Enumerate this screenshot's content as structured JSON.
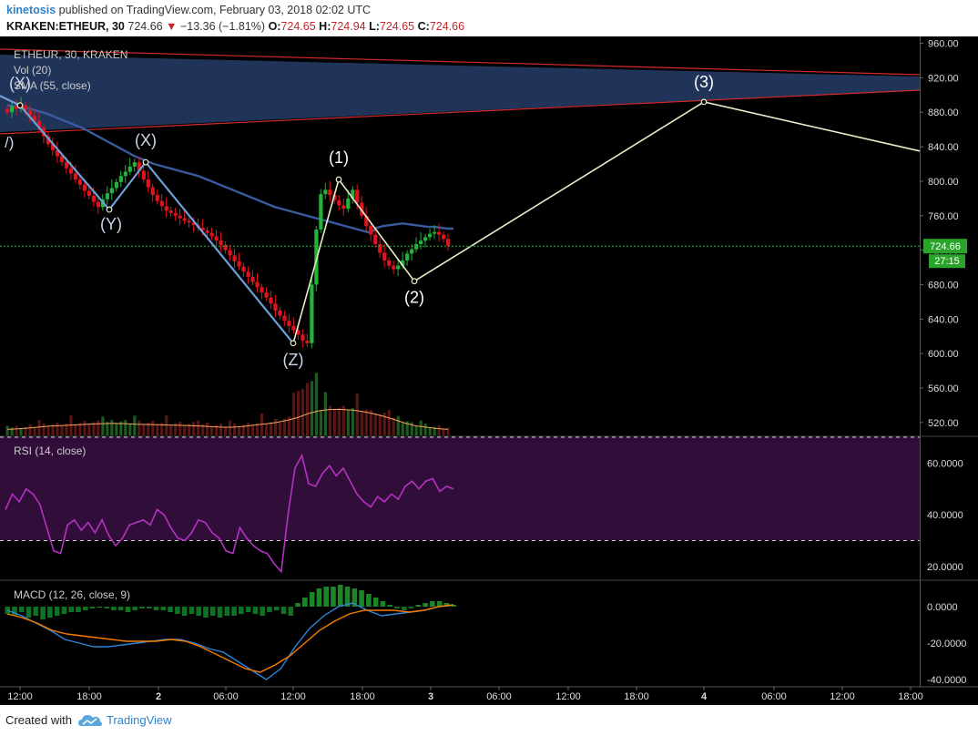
{
  "header": {
    "author": "kinetosis",
    "published_text": "published on TradingView.com, February 03, 2018 02:02 UTC",
    "symbol": "KRAKEN:ETHEUR, 30",
    "last": "724.66",
    "change_arrow": "▼",
    "change": "−13.36 (−1.81%)",
    "o_label": "O:",
    "o_value": "724.65",
    "h_label": "H:",
    "h_value": "724.94",
    "l_label": "L:",
    "l_value": "724.65",
    "c_label": "C:",
    "c_value": "724.66"
  },
  "footer": {
    "created_with": "Created with",
    "brand": "TradingView",
    "logo_icon": "tradingview-cloud-icon"
  },
  "colors": {
    "background": "#000000",
    "up": "#22b33a",
    "down": "#e0141c",
    "sma": "#3a5a9e",
    "wave": "#6f9fd8",
    "projection": "#e8ecc8",
    "channel_fill": "#3b5ea3",
    "channel_edge": "#d22a2a",
    "rsi_line": "#b332c2",
    "rsi_band": "#3a0f44",
    "macd_line": "#2b86d9",
    "signal_line": "#f57c00",
    "vol_ma": "#f4a460",
    "price_badge": "#2aa42a"
  },
  "chart_data": [
    {
      "type": "candlestick",
      "pane": "price",
      "title": "ETHEUR, 30, KRAKEN",
      "indicators": [
        "Vol (20)",
        "SMA (55, close)"
      ],
      "y_ticks": [
        "960.00",
        "920.00",
        "880.00",
        "840.00",
        "800.00",
        "760.00",
        "720.00",
        "680.00",
        "640.00",
        "600.00",
        "560.00",
        "520.00"
      ],
      "x_ticks": [
        "12:00",
        "18:00",
        "2",
        "06:00",
        "12:00",
        "18:00",
        "3",
        "06:00",
        "12:00",
        "18:00",
        "4",
        "06:00",
        "12:00",
        "18:00"
      ],
      "ylim": [
        505,
        968
      ],
      "last_price_label": "724.66",
      "countdown_label": "27:15",
      "close_series": [
        880,
        887,
        884,
        888,
        882,
        876,
        870,
        862,
        852,
        843,
        836,
        829,
        822,
        815,
        809,
        802,
        796,
        789,
        783,
        776,
        770,
        779,
        786,
        792,
        799,
        806,
        811,
        817,
        822,
        812,
        802,
        793,
        784,
        777,
        771,
        766,
        763,
        760,
        757,
        754,
        752,
        749,
        746,
        743,
        740,
        736,
        731,
        726,
        720,
        714,
        707,
        701,
        695,
        689,
        683,
        677,
        671,
        665,
        658,
        650,
        644,
        638,
        632,
        627,
        622,
        615,
        612,
        680,
        744,
        785,
        790,
        784,
        778,
        772,
        768,
        780,
        790,
        775,
        760,
        748,
        738,
        727,
        717,
        708,
        702,
        698,
        702,
        708,
        716,
        721,
        727,
        731,
        735,
        739,
        741,
        738,
        733,
        725
      ],
      "sma55": [
        888,
        887,
        886,
        885,
        883,
        881,
        879,
        876,
        873,
        870,
        867,
        864,
        861,
        857,
        853,
        849,
        845,
        841,
        837,
        833,
        829,
        826,
        823,
        820,
        818,
        816,
        814,
        812,
        810,
        808,
        806,
        803,
        800,
        797,
        794,
        791,
        788,
        785,
        782,
        779,
        776,
        773,
        770,
        768,
        766,
        764,
        762,
        760,
        758,
        756,
        754,
        752,
        750,
        748,
        746,
        744,
        742,
        740,
        746,
        748,
        749,
        750,
        751,
        750,
        749,
        748,
        747,
        747,
        746,
        745,
        745
      ],
      "vol_ma20": [
        0.22,
        0.24,
        0.27,
        0.31,
        0.34,
        0.36,
        0.38,
        0.4,
        0.42,
        0.43,
        0.44,
        0.43,
        0.41,
        0.4,
        0.39,
        0.38,
        0.37,
        0.36,
        0.34,
        0.32,
        0.3,
        0.3,
        0.33,
        0.38,
        0.42,
        0.47,
        0.55,
        0.65,
        0.8,
        0.9,
        0.95,
        0.95,
        0.93,
        0.88,
        0.8,
        0.7,
        0.58,
        0.45,
        0.35,
        0.3,
        0.25,
        0.22
      ],
      "annotations": [
        {
          "label": "(X)",
          "price": 888
        },
        {
          "label": "(Y)",
          "price": 767
        },
        {
          "label": "(X)",
          "price": 822
        },
        {
          "label": "(Z)",
          "price": 612
        },
        {
          "label": "(1)",
          "price": 802
        },
        {
          "label": "(2)",
          "price": 684
        },
        {
          "label": "(3)",
          "price": 892
        }
      ]
    },
    {
      "type": "line",
      "pane": "rsi",
      "title": "RSI (14, close)",
      "y_ticks": [
        "60.0000",
        "40.0000",
        "20.0000"
      ],
      "ylim": [
        15,
        70
      ],
      "bands": [
        70,
        30
      ],
      "values": [
        42,
        48,
        45,
        50,
        48,
        44,
        35,
        26,
        25,
        36,
        38,
        34,
        37,
        33,
        38,
        32,
        28,
        31,
        36,
        37,
        38,
        36,
        42,
        40,
        35,
        31,
        30,
        33,
        38,
        37,
        33,
        31,
        26,
        25,
        35,
        31,
        28,
        26,
        25,
        21,
        18,
        40,
        58,
        63,
        52,
        51,
        56,
        59,
        55,
        58,
        53,
        48,
        45,
        43,
        47,
        45,
        48,
        46,
        51,
        53,
        50,
        53,
        54,
        49,
        51,
        50
      ],
      "series": [
        {
          "name": "RSI"
        }
      ]
    },
    {
      "type": "bar+line",
      "pane": "macd",
      "title": "MACD (12, 26, close, 9)",
      "y_ticks": [
        "0.0000",
        "-20.0000",
        "-40.0000"
      ],
      "ylim": [
        -44,
        14
      ],
      "hist": [
        -4,
        -5,
        -3,
        -6,
        -5,
        -7,
        -6,
        -5,
        -4,
        -3,
        -3,
        -2,
        -1,
        0,
        -1,
        -2,
        -2,
        -3,
        -2,
        -1,
        -1,
        -2,
        -2,
        -3,
        -4,
        -5,
        -4,
        -5,
        -6,
        -5,
        -6,
        -5,
        -5,
        -4,
        -3,
        -4,
        -5,
        -3,
        -2,
        -4,
        -5,
        2,
        5,
        8,
        10,
        11,
        11,
        12,
        11,
        10,
        9,
        7,
        5,
        3,
        1,
        -1,
        -2,
        -1,
        1,
        2,
        3,
        3,
        2,
        1
      ],
      "macd_values": [
        -2,
        -5,
        -9,
        -13,
        -18,
        -20,
        -22,
        -22,
        -21,
        -20,
        -19,
        -18,
        -18,
        -20,
        -23,
        -25,
        -30,
        -35,
        -40,
        -34,
        -22,
        -12,
        -5,
        0,
        2,
        -2,
        -5,
        -4,
        -3,
        -2,
        0,
        1
      ],
      "signal_values": [
        -4,
        -6,
        -9,
        -13,
        -15,
        -16,
        -17,
        -18,
        -19,
        -19,
        -19,
        -18,
        -19,
        -22,
        -26,
        -30,
        -34,
        -36,
        -32,
        -27,
        -20,
        -13,
        -8,
        -4,
        -2,
        -2,
        -2,
        -3,
        -2,
        0,
        1
      ]
    }
  ]
}
